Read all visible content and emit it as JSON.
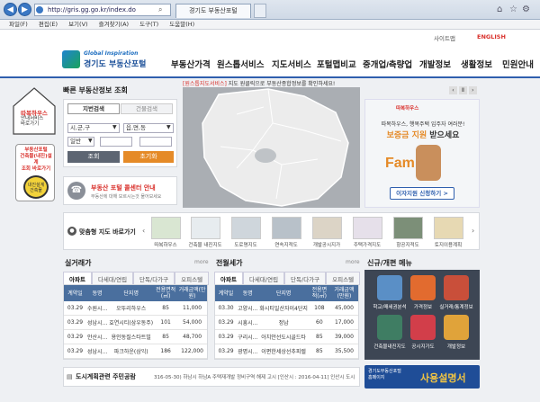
{
  "browser": {
    "url": "http://gris.gg.go.kr/index.do",
    "tab_title": "경기도 부동산포털",
    "menu": [
      "파일(F)",
      "편집(E)",
      "보기(V)",
      "즐겨찾기(A)",
      "도구(T)",
      "도움말(H)"
    ]
  },
  "topbar": {
    "sitemap": "사이트맵",
    "english": "ENGLISH"
  },
  "header": {
    "logo_top": "Global Inspiration",
    "logo_main": "경기도 부동산포털",
    "nav": [
      "부동산가격",
      "원스톱서비스",
      "지도서비스",
      "포털맵비교",
      "중개업/측량업",
      "개발정보",
      "생활정보",
      "민원안내"
    ]
  },
  "left": {
    "house_title": "따복하우스",
    "house_sub": "안내서비스\n바로가기",
    "check_title": "부동산포털\n건축물(내진)설계\n조회 바로가기",
    "check_badge": "내진설계\n건축물"
  },
  "search": {
    "title": "빠른 부동산정보 조회",
    "tab1": "지번검색",
    "tab2": "건물검색",
    "sel1": "시,군,구",
    "sel2": "읍,면,동",
    "sel3": "일반",
    "btn1": "조회",
    "btn2": "초기화"
  },
  "callcenter": {
    "title": "부동산 포털 콜센터 안내",
    "sub": "부동산에 대해 모르시는것 물어보세요"
  },
  "map": {
    "caption_highlight": "[원스톱지도서비스]",
    "caption_rest": "지도 원클릭으로 부동산종합정보를 확인하세요!"
  },
  "banner": {
    "brand": "따복하우스",
    "line1": "따복하우스, 행복주택 입주자 여러분!",
    "line2": "보증금 지원",
    "line2b": "받으세요",
    "fam": "Family",
    "apply": "이자지원 신청하기 >"
  },
  "quickmap": {
    "title": "맞춤형 지도 바로가기",
    "items": [
      "따복하우스",
      "건축물 내진지도",
      "도로명지도",
      "연속지적도",
      "개발공시지가",
      "주택가격지도",
      "항공지적도",
      "토지이용계획"
    ]
  },
  "price": {
    "title": "실거래가",
    "more": "more",
    "tabs": [
      "아파트",
      "다세대/연립",
      "단독/다가구",
      "오피스텔"
    ],
    "headers": [
      "계약일",
      "동명",
      "단지명",
      "전용면적(㎡)",
      "거래금액(만원)"
    ],
    "rows": [
      [
        "03.29",
        "수원시...",
        "오뚜리하우스",
        "85",
        "11,000"
      ],
      [
        "03.29",
        "성남시...",
        "효연시티(삼우동주)",
        "101",
        "54,000"
      ],
      [
        "03.29",
        "안산시...",
        "용인동질스타트빌",
        "85",
        "48,700"
      ],
      [
        "03.29",
        "성남시...",
        "파크하운(삼익)",
        "186",
        "122,000"
      ]
    ]
  },
  "rent": {
    "title": "전월세가",
    "more": "more",
    "tabs": [
      "아파트",
      "다세대/연립",
      "단독/다가구",
      "오피스텔"
    ],
    "headers": [
      "계약일",
      "동명",
      "단지명",
      "전용면적(㎡)",
      "거래금액(만원)"
    ],
    "rows": [
      [
        "03.30",
        "고양시...",
        "화시티일산자이4단지",
        "108",
        "45,000"
      ],
      [
        "03.29",
        "시흥시...",
        "정남",
        "60",
        "17,000"
      ],
      [
        "03.29",
        "구리시...",
        "아치안선도시골드타",
        "85",
        "39,000"
      ],
      [
        "03.29",
        "광명시...",
        "이편한세상선추피렐",
        "85",
        "35,500"
      ]
    ]
  },
  "services": {
    "title": "신규/개편 메뉴",
    "items": [
      "학교/매세권분석",
      "가격정보",
      "실거래/통계정보",
      "건축물내진지도",
      "공시지가도",
      "개발정보"
    ]
  },
  "notice": {
    "label": "도시계획관련 주민공람",
    "text": "316-05-30) 하남시 하남A 주택재개발 정비구역 해제 고시 [인산시 : 2016-04-11] 인산시 도시",
    "manual_small": "경기도부동산포털\n홈페이지",
    "manual_big": "사용설명서"
  },
  "colors": {
    "brand_blue": "#2f5fae",
    "accent_orange": "#e58a27",
    "table_header": "#4a6f9e",
    "red": "#d9302b"
  }
}
